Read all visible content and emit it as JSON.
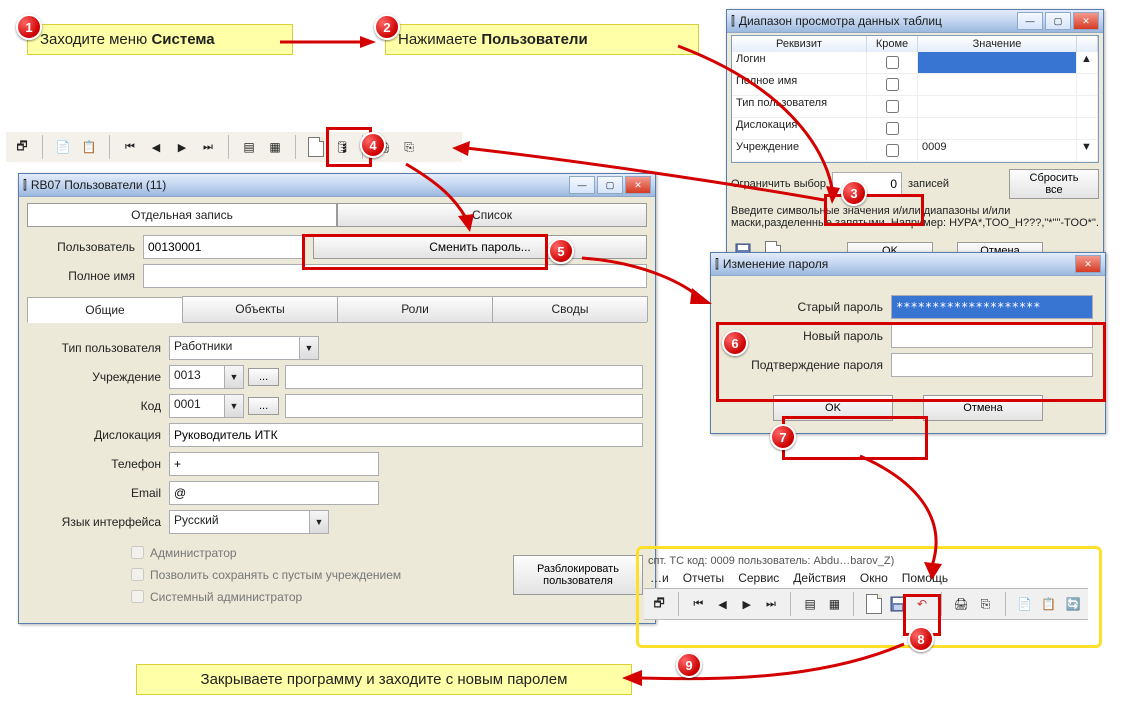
{
  "callouts": {
    "n1": "1",
    "n2": "2",
    "n3": "3",
    "n4": "4",
    "n5": "5",
    "n6": "6",
    "n7": "7",
    "n8": "8",
    "n9": "9"
  },
  "notes": {
    "step1_a": "Заходите меню ",
    "step1_b": "Система",
    "step2_a": "Нажимаете ",
    "step2_b": "Пользователи",
    "step9": "Закрываете программу и заходите с новым паролем"
  },
  "filter_win": {
    "title": "Диапазон просмотра данных таблиц",
    "cols": {
      "c1": "Реквизит",
      "c2": "Кроме",
      "c3": "Значение"
    },
    "rows": {
      "r1": "Логин",
      "r2": "Полное имя",
      "r3": "Тип пользователя",
      "r4": "Дислокация",
      "r5": "Учреждение"
    },
    "val_r5": "0009",
    "limit_label": "Ограничить выбор",
    "limit_value": "0",
    "limit_suffix": "записей",
    "hint": "Введите символьные значения и/или диапазоны и/или маски,разделенные запятыми. Например: НУРА*,TOO_Н???,\"*\"\"-TOO*\".",
    "reset": "Сбросить все",
    "ok": "OK",
    "cancel": "Отмена"
  },
  "users_win": {
    "title": "RB07 Пользователи (11)",
    "tab_single": "Отдельная запись",
    "tab_list": "Список",
    "lbl_user": "Пользователь",
    "val_user": "00130001",
    "btn_change_pwd": "Сменить пароль...",
    "lbl_fullname": "Полное имя",
    "tabs2": {
      "t1": "Общие",
      "t2": "Объекты",
      "t3": "Роли",
      "t4": "Своды"
    },
    "lbl_type": "Тип пользователя",
    "val_type": "Работники",
    "lbl_org": "Учреждение",
    "val_org": "0013",
    "lbl_code": "Код",
    "val_code": "0001",
    "lbl_disloc": "Дислокация",
    "val_disloc": "Руководитель ИТК",
    "lbl_phone": "Телефон",
    "val_phone": "+",
    "lbl_email": "Email",
    "val_email": "@",
    "lbl_lang": "Язык интерфейса",
    "val_lang": "Русский",
    "chk_admin": "Администратор",
    "chk_allow_empty": "Позволить сохранять с пустым учреждением",
    "chk_sysadmin": "Системный администратор",
    "btn_unlock": "Разблокировать пользователя",
    "dots": "..."
  },
  "pwd_win": {
    "title": "Изменение пароля",
    "lbl_old": "Старый пароль",
    "val_old": "********************",
    "lbl_new": "Новый пароль",
    "lbl_confirm": "Подтверждение пароля",
    "ok": "OK",
    "cancel": "Отмена"
  },
  "menubar": {
    "title_frag": "спт. ТС код: 0009 пользователь: Abdu…barov_Z)",
    "m2": "Отчеты",
    "m3": "Сервис",
    "m4": "Действия",
    "m5": "Окно",
    "m6": "Помощь"
  }
}
